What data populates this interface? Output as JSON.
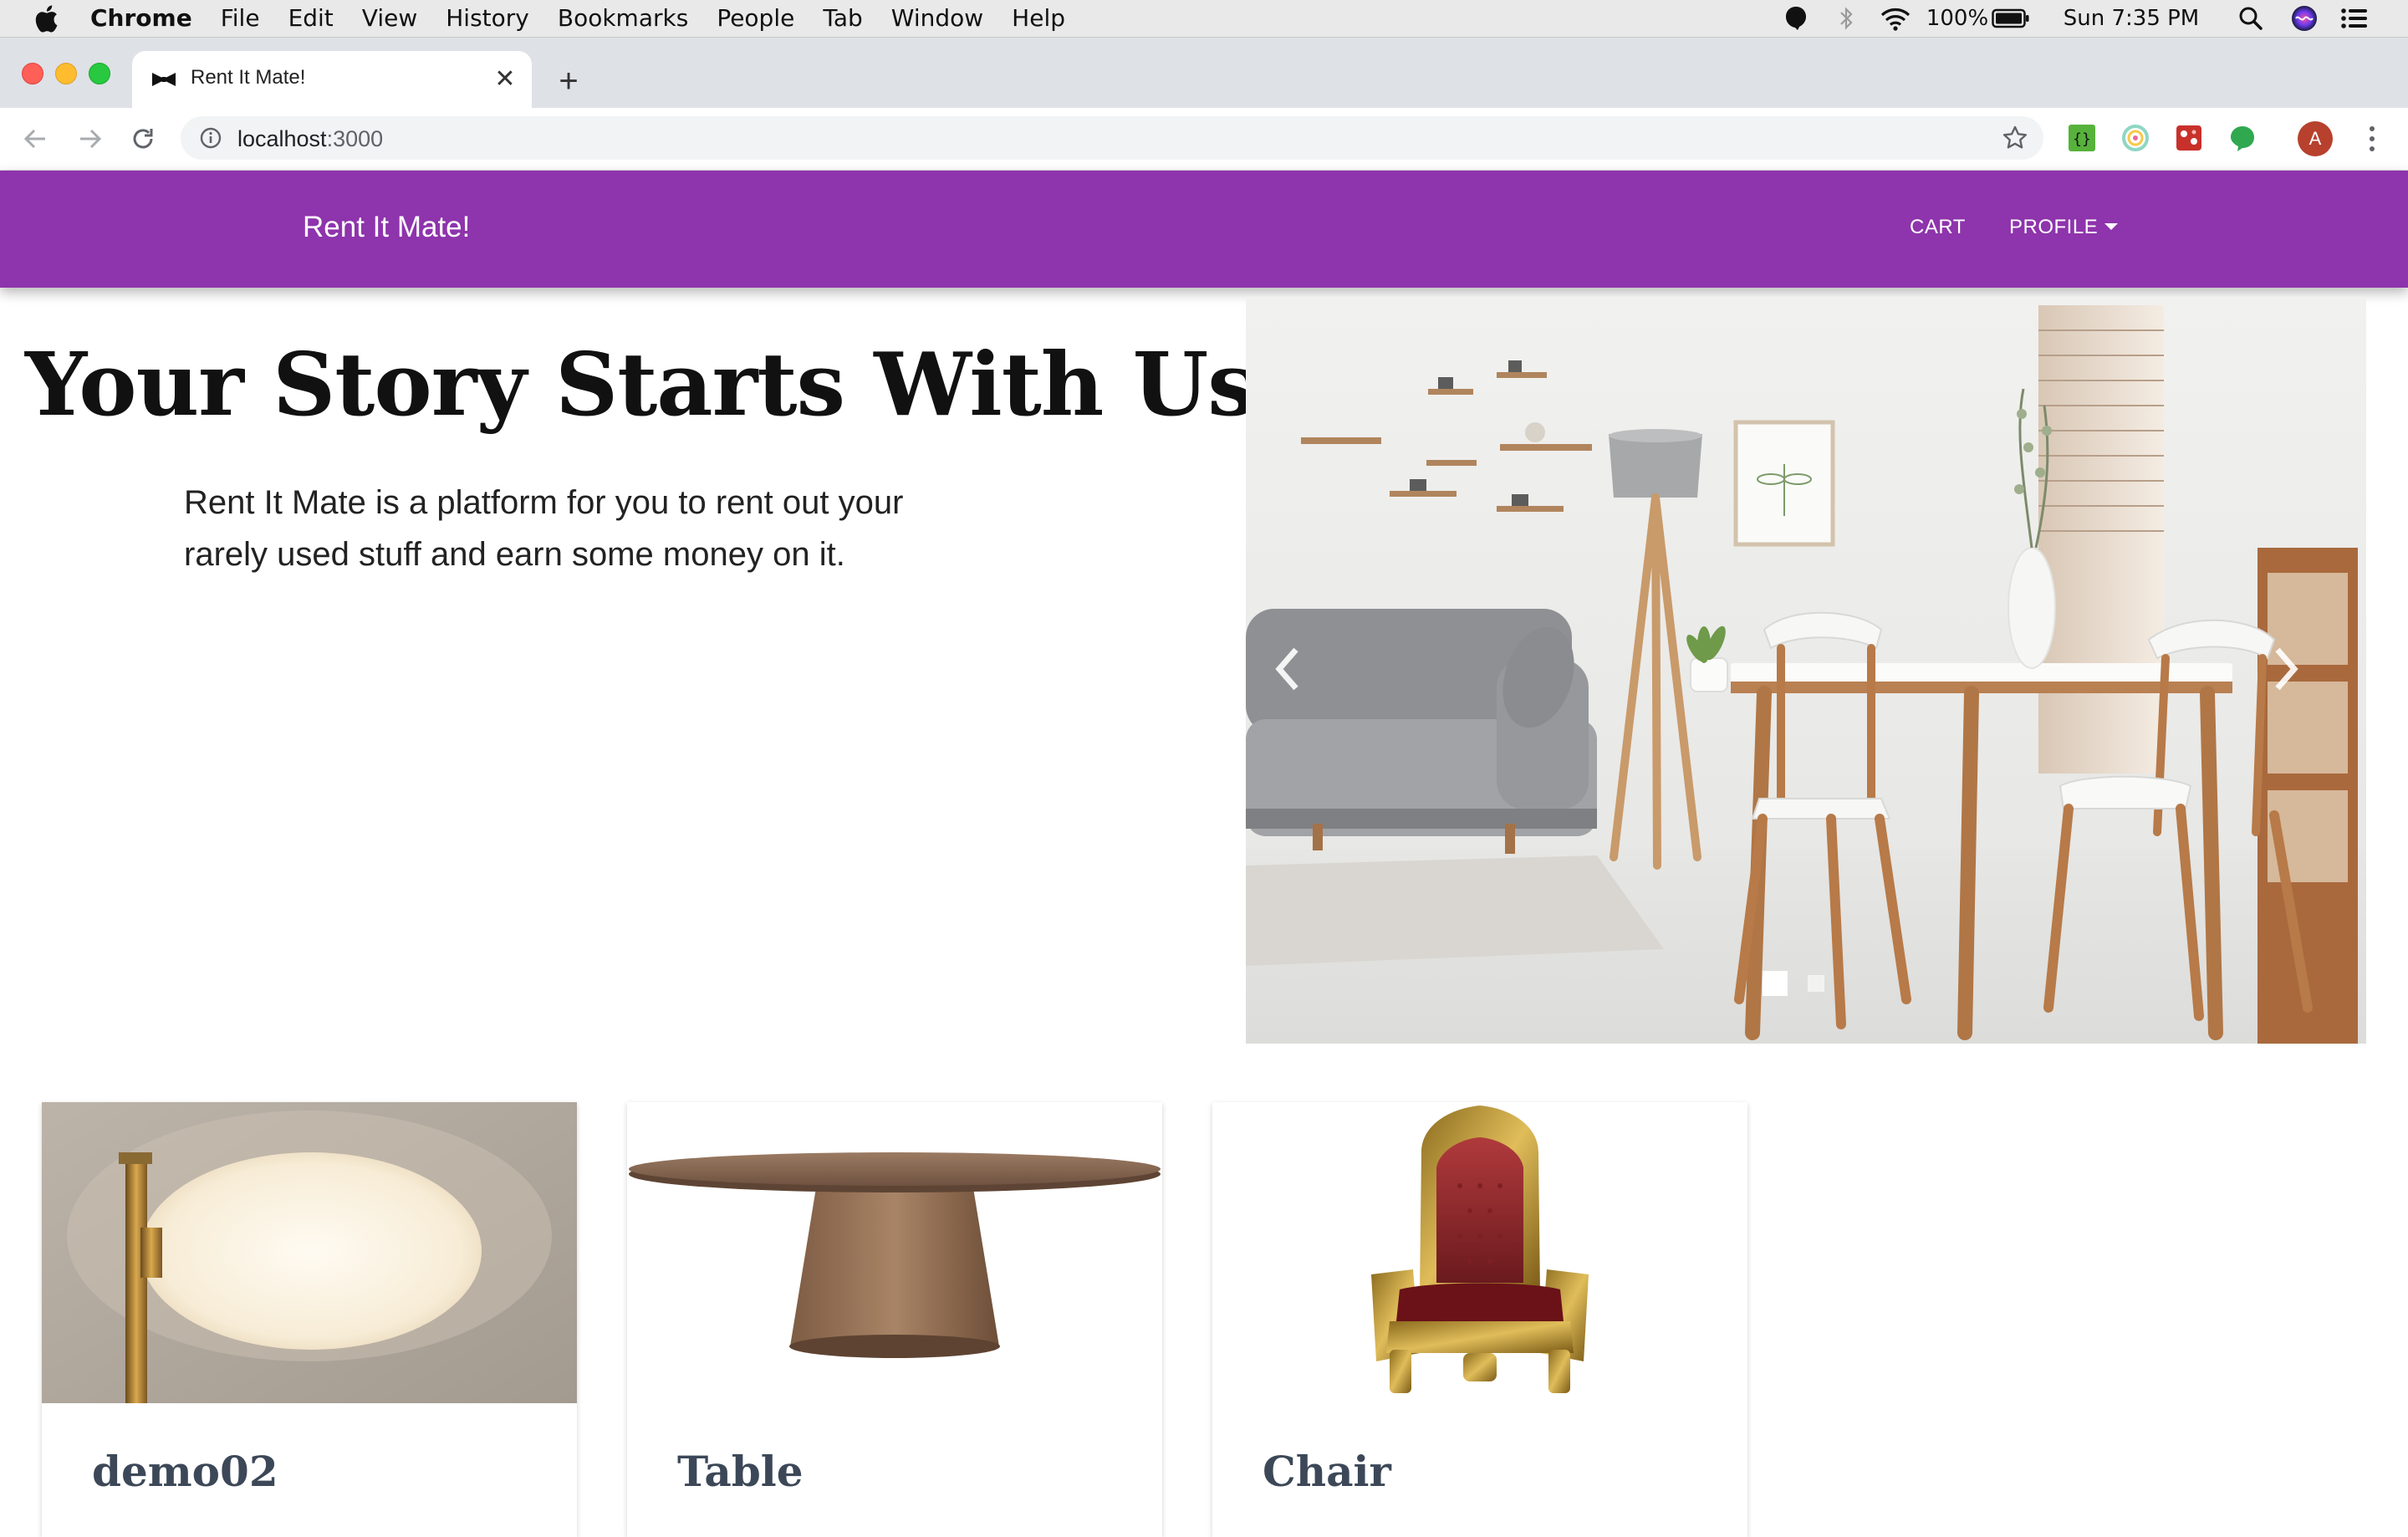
{
  "menubar": {
    "app": "Chrome",
    "items": [
      "File",
      "Edit",
      "View",
      "History",
      "Bookmarks",
      "People",
      "Tab",
      "Window",
      "Help"
    ],
    "battery": "100%",
    "clock": "Sun 7:35 PM"
  },
  "browser": {
    "tab_title": "Rent It Mate!",
    "url_host": "localhost",
    "url_port": ":3000",
    "extensions": [
      "json-viewer-icon",
      "color-picker-icon",
      "puzzle-extension-icon",
      "green-leaf-icon"
    ],
    "profile_initial": "A"
  },
  "nav": {
    "brand": "Rent It Mate!",
    "links": {
      "cart": "CART",
      "profile": "PROFILE"
    },
    "color": "#8e34ac"
  },
  "hero": {
    "headline": "Your Story Starts With Us.",
    "lead": "Rent It Mate is a platform for you to rent out your rarely used stuff and earn some money on it."
  },
  "carousel": {
    "slides": 2,
    "active_slide": 1
  },
  "cards": [
    {
      "title": "demo02",
      "image": "lamp"
    },
    {
      "title": "Table",
      "image": "table"
    },
    {
      "title": "Chair",
      "image": "throne-chair"
    }
  ]
}
